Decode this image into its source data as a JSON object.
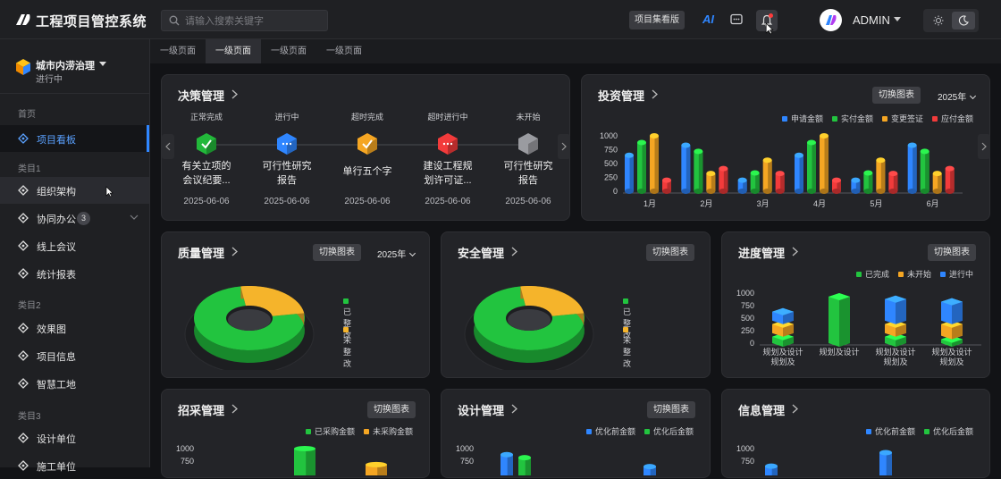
{
  "app": {
    "title": "工程项目管控系统"
  },
  "search": {
    "placeholder": "请输入搜索关键字"
  },
  "header": {
    "overview_label": "项目集看版",
    "ai_label": "AI",
    "user_name": "ADMIN"
  },
  "project": {
    "name": "城市内涝治理",
    "status": "进行中"
  },
  "sidebar": {
    "home": "首页",
    "board": "项目看板",
    "cat1": "类目1",
    "org": "组织架构",
    "collab": "协同办公",
    "collab_badge": "3",
    "meeting": "线上会议",
    "report": "统计报表",
    "cat2": "类目2",
    "render": "效果图",
    "info": "项目信息",
    "site": "智慧工地",
    "cat3": "类目3",
    "design_unit": "设计单位",
    "build_unit": "施工单位"
  },
  "tabs": [
    "一级页面",
    "一级页面",
    "一级页面",
    "一级页面"
  ],
  "common": {
    "switch": "切换图表",
    "year": "2025年"
  },
  "decision": {
    "title": "决策管理",
    "steps": [
      {
        "status": "正常完成",
        "name": "有关立项的会议纪要...",
        "date": "2025-06-06",
        "color": "#22b83a"
      },
      {
        "status": "进行中",
        "name": "可行性研究报告",
        "date": "2025-06-06",
        "color": "#2f86ff"
      },
      {
        "status": "超时完成",
        "name": "单行五个字",
        "date": "2025-06-06",
        "color": "#f5a623"
      },
      {
        "status": "超时进行中",
        "name": "建设工程规划许可证...",
        "date": "2025-06-06",
        "color": "#f23b3b"
      },
      {
        "status": "未开始",
        "name": "可行性研究报告",
        "date": "2025-06-06",
        "color": "#9a9ba0"
      }
    ]
  },
  "investment": {
    "title": "投资管理",
    "chart_data": {
      "type": "bar",
      "categories": [
        "1月",
        "2月",
        "3月",
        "4月",
        "5月",
        "6月"
      ],
      "ylim": [
        0,
        1000
      ],
      "yticks": [
        0,
        250,
        500,
        750,
        1000
      ],
      "series": [
        {
          "name": "申请金额",
          "color": "#2f86ff",
          "values": [
            650,
            830,
            200,
            650,
            200,
            830
          ]
        },
        {
          "name": "实付金额",
          "color": "#22c43f",
          "values": [
            880,
            720,
            330,
            880,
            330,
            720
          ]
        },
        {
          "name": "变更签证",
          "color": "#f5a623",
          "values": [
            1000,
            320,
            560,
            1000,
            560,
            320
          ]
        },
        {
          "name": "应付金额",
          "color": "#f23b3b",
          "values": [
            200,
            410,
            320,
            200,
            320,
            410
          ]
        }
      ]
    }
  },
  "quality": {
    "title": "质量管理",
    "chart_data": {
      "type": "pie",
      "slices": [
        {
          "name": "已整改",
          "value": 75,
          "color": "#22c43f"
        },
        {
          "name": "未整改",
          "value": 25,
          "color": "#f5b42b"
        }
      ]
    }
  },
  "safety": {
    "title": "安全管理",
    "chart_data": {
      "type": "pie",
      "slices": [
        {
          "name": "已整改",
          "value": 75,
          "color": "#22c43f"
        },
        {
          "name": "未整改",
          "value": 25,
          "color": "#f5b42b"
        }
      ]
    }
  },
  "progress": {
    "title": "进度管理",
    "chart_data": {
      "type": "bar",
      "stacked": true,
      "categories": [
        "规划及设计规划及",
        "规划及设计",
        "规划及设计规划及",
        "规划及设计规划及"
      ],
      "ylim": [
        0,
        1000
      ],
      "yticks": [
        0,
        250,
        500,
        750,
        1000
      ],
      "series": [
        {
          "name": "已完成",
          "color": "#22c43f",
          "values": [
            200,
            1000,
            200,
            150
          ]
        },
        {
          "name": "未开始",
          "color": "#f5a623",
          "values": [
            250,
            0,
            250,
            300
          ]
        },
        {
          "name": "进行中",
          "color": "#2f86ff",
          "values": [
            250,
            0,
            500,
            450
          ]
        }
      ]
    }
  },
  "procurement": {
    "title": "招采管理",
    "chart_data": {
      "type": "bar",
      "ylim": [
        0,
        1000
      ],
      "yticks": [
        750,
        1000
      ],
      "series": [
        {
          "name": "已采购金额",
          "color": "#22c43f",
          "values": [
            1000
          ]
        },
        {
          "name": "未采购金额",
          "color": "#f5a623",
          "values": [
            680
          ]
        }
      ]
    }
  },
  "design": {
    "title": "设计管理",
    "chart_data": {
      "type": "bar",
      "ylim": [
        0,
        1000
      ],
      "yticks": [
        750,
        1000
      ],
      "series": [
        {
          "name": "优化前金额",
          "color": "#2f86ff",
          "values": [
            880,
            640
          ]
        },
        {
          "name": "优化后金额",
          "color": "#22c43f",
          "values": [
            820
          ]
        }
      ]
    }
  },
  "information": {
    "title": "信息管理",
    "chart_data": {
      "type": "bar",
      "ylim": [
        0,
        1000
      ],
      "yticks": [
        750,
        1000
      ],
      "series": [
        {
          "name": "优化前金额",
          "color": "#2f86ff",
          "values": [
            650,
            920
          ]
        },
        {
          "name": "优化后金额",
          "color": "#22c43f",
          "values": []
        }
      ]
    }
  }
}
